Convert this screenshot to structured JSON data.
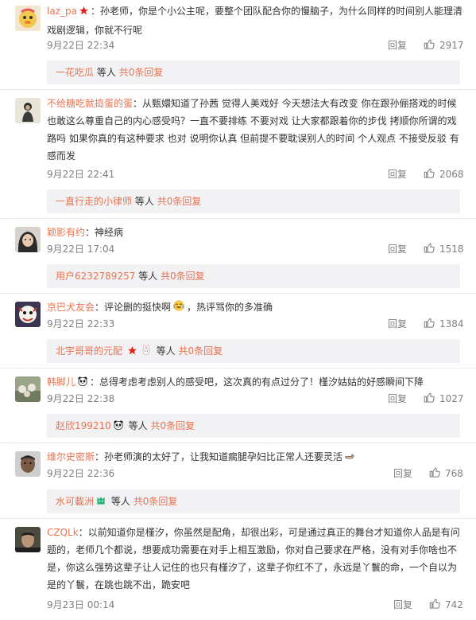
{
  "comments": [
    {
      "user": "laz_pa",
      "separator": "：",
      "text": "孙老师，你是个小公主呢，要整个团队配合你的慢脑子，为什么同样的时间别人能理清戏剧逻辑，你就不行呢",
      "time": "9月22日 22:34",
      "reply_label": "回复",
      "likes": "2917",
      "sub_user": "一花吃瓜",
      "sub_text": "等人",
      "sub_link": "共0条回复"
    },
    {
      "user": "不给糖吃就捣蛋的蛋",
      "separator": "：",
      "text": "从甄嬛知道了孙茜 觉得人美戏好 今天想法大有改变 你在跟孙俪搭戏的时候也敢这么尊重自己的内心感受吗？一直不要排练 不要对戏 让大家都跟着你的步伐 拷顺你所谓的戏路吗 如果你真的有这种要求 也对 说明你认真 但前提不要耽误别人的时间 个人观点 不接受反驳 有感而发",
      "time": "9月22日 22:41",
      "reply_label": "回复",
      "likes": "2068",
      "sub_user": "一直行走的小律师",
      "sub_text": "等人",
      "sub_link": "共0条回复"
    },
    {
      "user": "颖影有约",
      "separator": "：",
      "text": "神经病",
      "time": "9月22日 17:04",
      "reply_label": "回复",
      "likes": "1518",
      "sub_user": "用户6232789257",
      "sub_text": "等人",
      "sub_link": "共0条回复"
    },
    {
      "user": "京巴犬友会",
      "separator": "：",
      "text": "评论删的挺快啊",
      "text_after": "，热评骂你的多准确",
      "time": "9月22日 22:33",
      "reply_label": "回复",
      "likes": "1384",
      "sub_user": "北宇哥哥的元配",
      "sub_text": "等人",
      "sub_link": "共0条回复"
    },
    {
      "user": "韩脚儿",
      "separator": "：",
      "text": "总得考虑考虑别人的感受吧，这次真的有点过分了！槿汐姑姑的好感瞬间下降",
      "time": "9月22日 22:38",
      "reply_label": "回复",
      "likes": "1027",
      "sub_user": "赵欣199210",
      "sub_text": "等人",
      "sub_link": "共0条回复"
    },
    {
      "user": "维尔史密斯",
      "separator": "：",
      "text": "孙老师演的太好了，让我知道瘸腿孕妇比正常人还要灵活",
      "time": "9月22日 22:36",
      "reply_label": "回复",
      "likes": "768",
      "sub_user": "水可載洲",
      "sub_text": "等人",
      "sub_link": "共0条回复"
    },
    {
      "user": "CZQLk",
      "separator": "：",
      "text": "以前知道你是槿汐，你虽然是配角，却很出彩，可是通过真正的舞台才知道你人品是有问题的，老师几个都说，想要成功需要在对手上相互激励，你对自己要求在严格，没有对手你啥也不是，你这么强势这辈子让人记住的也只有槿汐了，这辈子你红不了，永远是丫鬟的命，一个自以为是的丫鬟，在跳也跳不出，跪安吧",
      "time": "9月23日 00:14",
      "reply_label": "回复",
      "likes": "742"
    }
  ],
  "colors": {
    "link": "#eb7350",
    "meta": "#808080",
    "subbox_bg": "#f2f2f5",
    "separator": "#e8e8e8"
  },
  "icons": {
    "like": "thumbs-up-icon",
    "vip": "red-star-icon",
    "emoji": "emoji-icon"
  }
}
